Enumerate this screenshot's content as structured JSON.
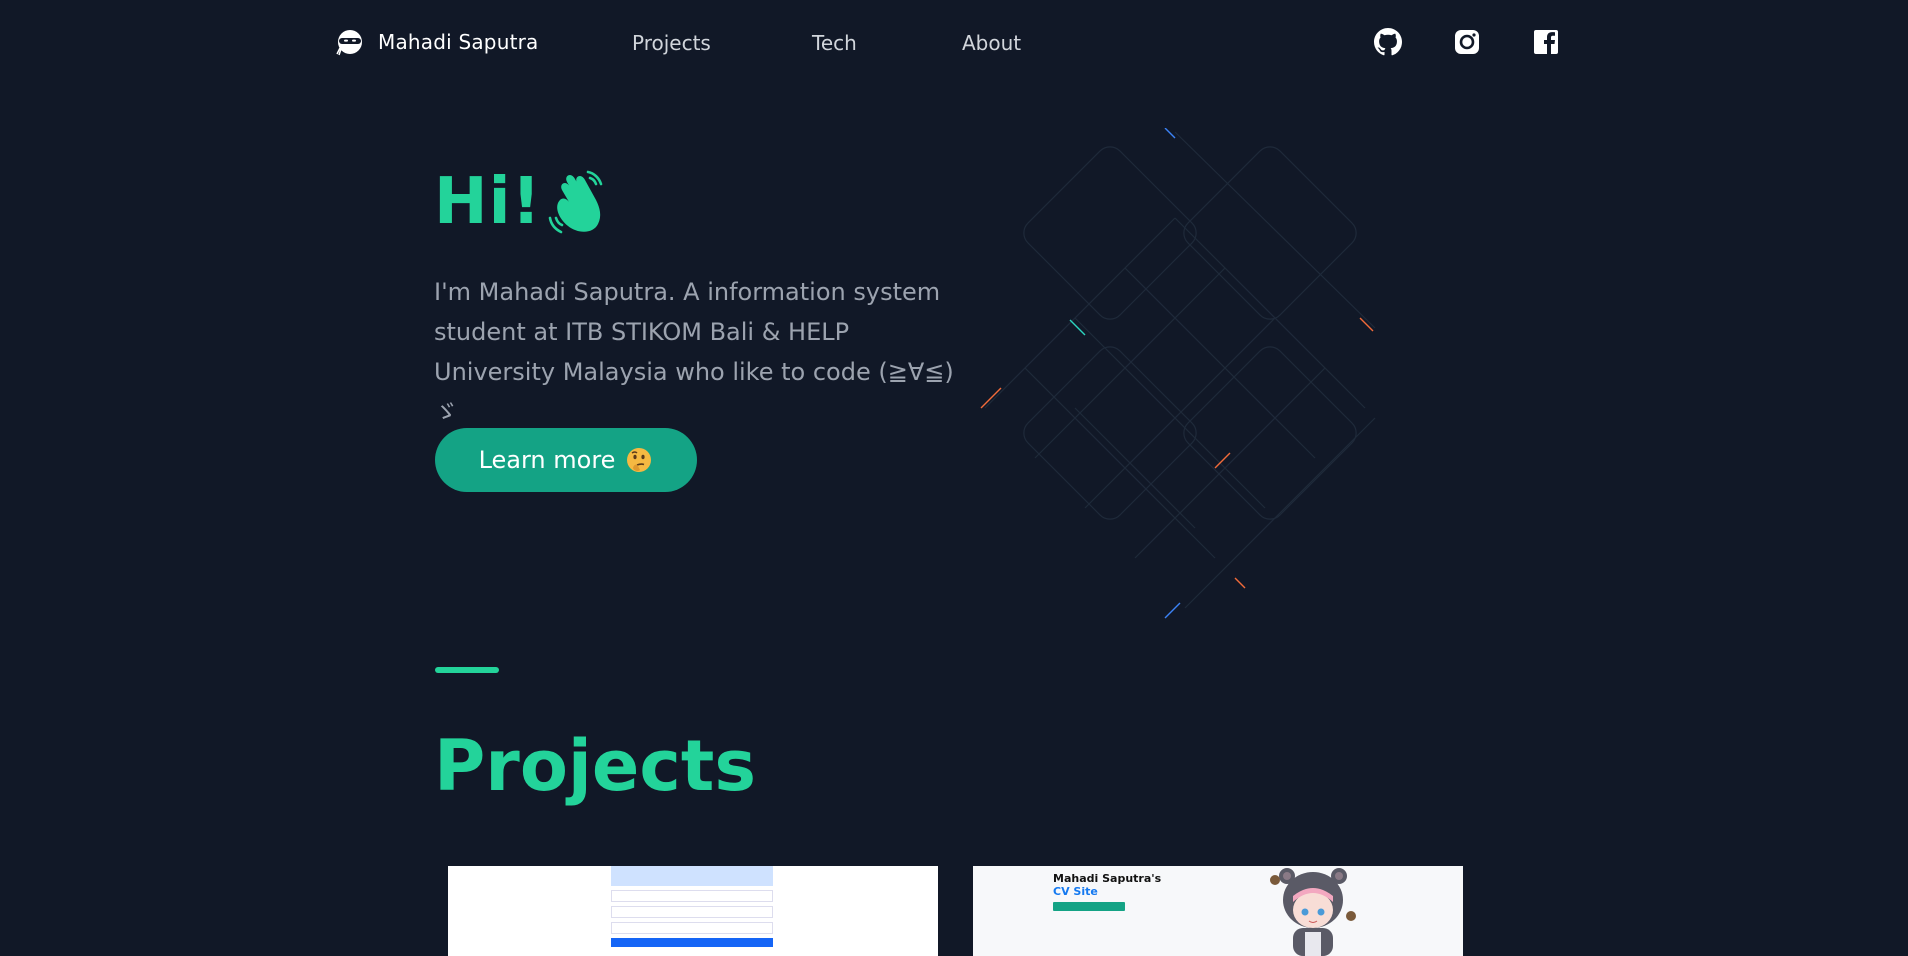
{
  "nav": {
    "brand_name": "Mahadi Saputra",
    "links": [
      "Projects",
      "Tech",
      "About"
    ],
    "social": [
      "github-icon",
      "instagram-icon",
      "facebook-icon"
    ]
  },
  "hero": {
    "title": "Hi!",
    "description": "I'm Mahadi Saputra. A information system student at ITB STIKOM Bali & HELP University Malaysia who like to code (≧∀≦) ゞ",
    "button_label": "Learn more"
  },
  "projects": {
    "title": "Projects",
    "card1": {
      "note": "",
      "fields": [
        "",
        "",
        ""
      ],
      "button": "",
      "footer": ""
    },
    "card2": {
      "title": "Mahadi Saputra's",
      "subtitle": "CV Site",
      "text": "",
      "button": ""
    }
  },
  "colors": {
    "background": "#111827",
    "accent": "#23d39a",
    "button": "#14a385",
    "text_muted": "#9ca3af"
  }
}
